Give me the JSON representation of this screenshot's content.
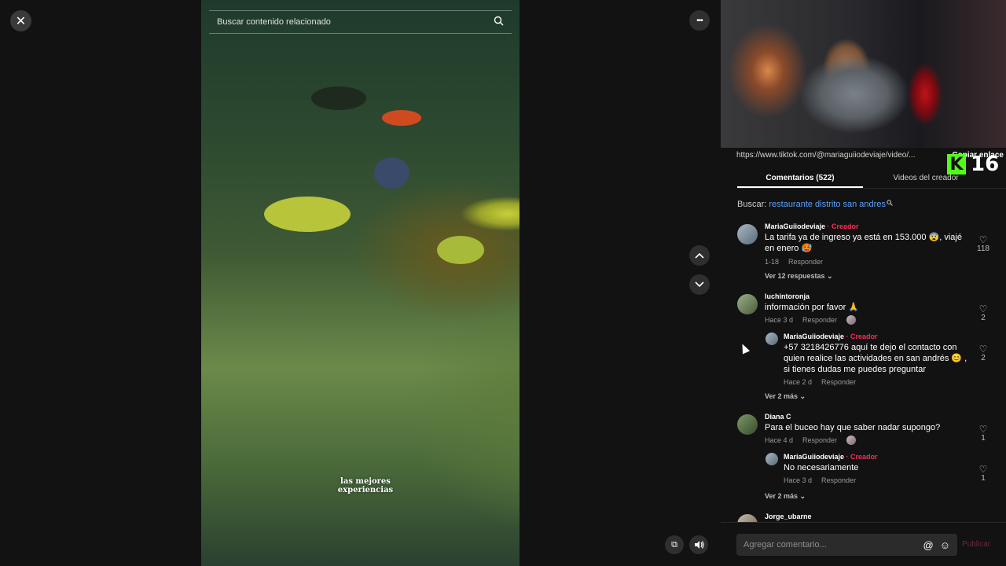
{
  "video": {
    "search_placeholder": "Buscar contenido relacionado",
    "caption_line1": "las mejores",
    "caption_line2": "experiencias"
  },
  "controls": {
    "close_icon": "✕",
    "more_icon": "•••",
    "up_icon": "︿",
    "down_icon": "﹀",
    "mini_icon": "⧉",
    "volume_icon": "🔊"
  },
  "panel": {
    "link_url": "https://www.tiktok.com/@mariaguiiodeviaje/video/...",
    "copy_link": "Copiar enlace",
    "kick_letter": "K",
    "kick_count": "16",
    "tabs": [
      {
        "label": "Comentarios (522)"
      },
      {
        "label": "Videos del creador"
      }
    ],
    "search_prefix": "Buscar: ",
    "search_term": "restaurante distrito san andres"
  },
  "comments": [
    {
      "user": "MariaGuiiodeviaje",
      "creator_tag": " · Creador",
      "text": "La tarifa ya de ingreso ya está en 153.000 😨, viajé en enero 🥵",
      "date": "1-18",
      "reply": "Responder",
      "likes": "118",
      "view_more": "Ver 12 respuestas ⌄"
    },
    {
      "user": "luchintoronja",
      "text": "información por favor 🙏",
      "date": "Hace 3 d",
      "reply": "Responder",
      "likes": "2"
    },
    {
      "user": "MariaGuiiodeviaje",
      "creator_tag": " · Creador",
      "text": "+57 3218426776 aquí te dejo el contacto con quien realice las actividades en san andrés 😊 , si tienes dudas me puedes preguntar",
      "date": "Hace 2 d",
      "reply": "Responder",
      "likes": "2",
      "view_more": "Ver 2 más ⌄"
    },
    {
      "user": "Diana C",
      "text": "Para el buceo hay que saber nadar supongo?",
      "date": "Hace 4 d",
      "reply": "Responder",
      "likes": "1"
    },
    {
      "user": "MariaGuiiodeviaje",
      "creator_tag": " · Creador",
      "text": "No necesariamente",
      "date": "Hace 3 d",
      "reply": "Responder",
      "likes": "1",
      "view_more": "Ver 2 más ⌄"
    },
    {
      "user": "Jorge_ubarne"
    }
  ],
  "composer": {
    "placeholder": "Agregar comentario...",
    "at_icon": "@",
    "emoji_icon": "☺",
    "publish": "Publicar"
  },
  "colors": {
    "creator": "#fe2c55",
    "search_term": "#5aa2ff",
    "kick_green": "#53fc18"
  }
}
